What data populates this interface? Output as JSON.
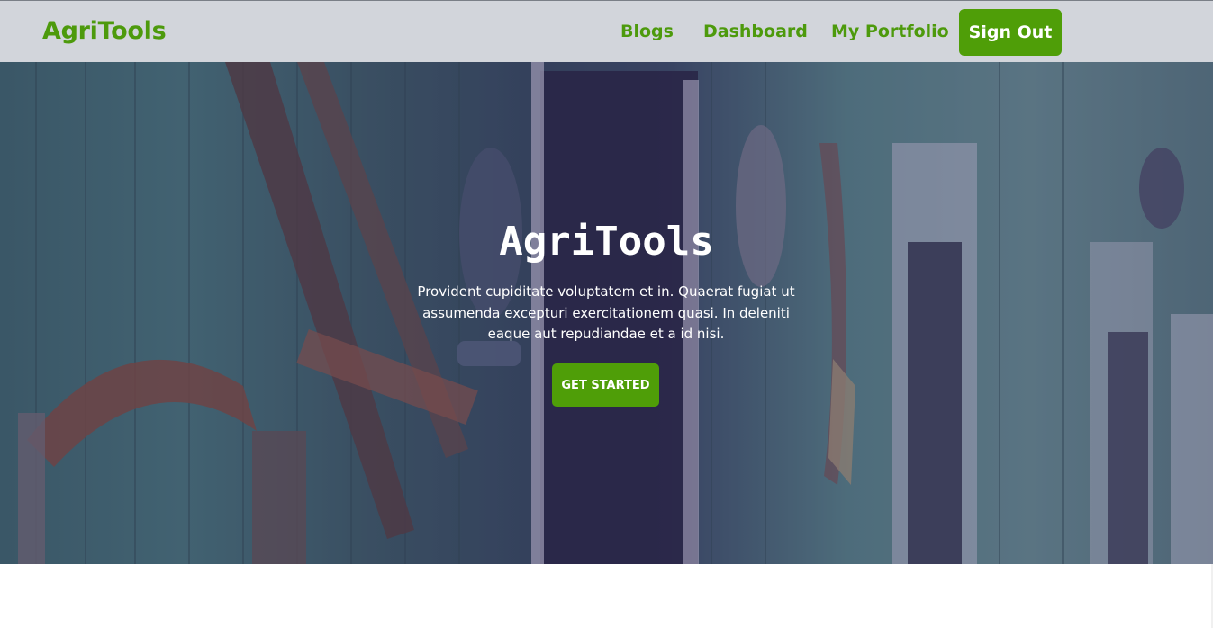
{
  "navbar": {
    "brand": "AgriTools",
    "links": [
      "Blogs",
      "Dashboard",
      "My Portfolio"
    ],
    "signout_label": "Sign Out"
  },
  "hero": {
    "title": "AgriTools",
    "text": "Provident cupiditate voluptatem et in. Quaerat fugiat ut assumenda excepturi exercitationem quasi. In deleniti eaque aut repudiandae et a id nisi.",
    "cta_label": "GET STARTED",
    "background_description_icon": "barn-wall-tools-photo"
  },
  "colors": {
    "accent": "#4f9e08",
    "navbar_bg": "#d2d5db",
    "overlay": "#32305f"
  }
}
